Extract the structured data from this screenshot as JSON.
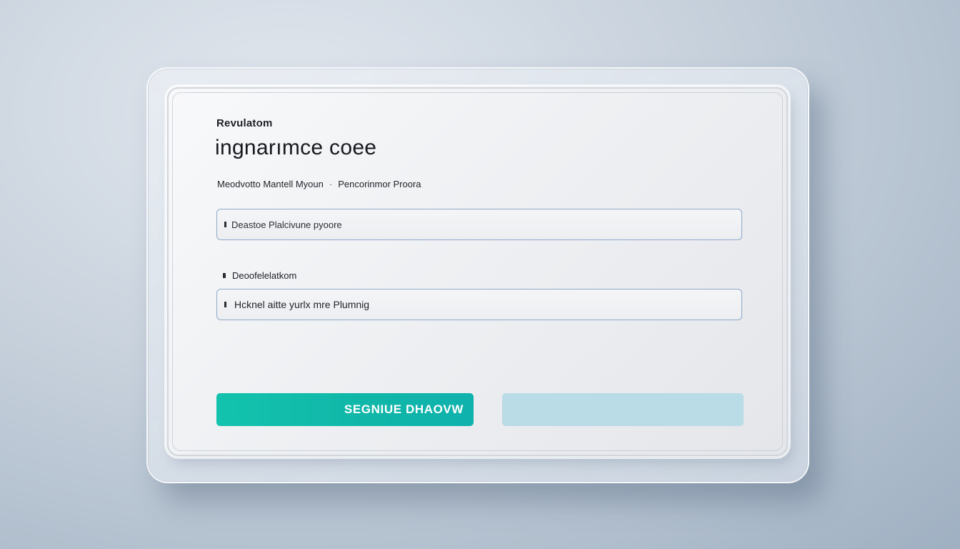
{
  "form": {
    "eyebrow": "Revulatom",
    "title": "ingnarımce coee",
    "subline_left": "Meodvotto Mantell Myoun",
    "subline_separator": "·",
    "subline_right": "Pencorinmor Proora",
    "field_1": {
      "value": "Deastoe Plalcivune pyoore"
    },
    "field_2": {
      "label": "Deoofelelatkom",
      "value": "Hcknel aitte yurlx mre Plumnig"
    },
    "primary_button": {
      "label": "SEGNIUE DHAOVW"
    },
    "secondary_button": {
      "label": ""
    }
  },
  "colors": {
    "accent": "#13c3ad",
    "secondary_button": "#b9dce6",
    "field_border": "#90aac9"
  }
}
